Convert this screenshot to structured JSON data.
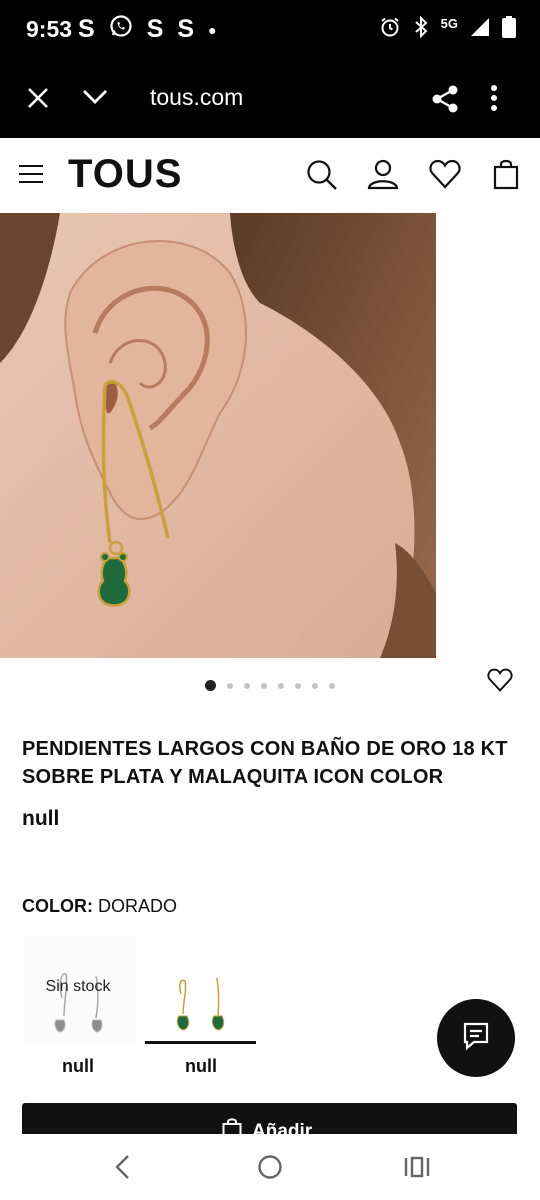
{
  "status": {
    "time": "9:53",
    "notif_icons": [
      "s-app-icon",
      "whatsapp-icon",
      "s-app-icon",
      "s-app-icon",
      "dot-icon"
    ],
    "notif_s": "S",
    "network": "5G"
  },
  "browser": {
    "url": "tous.com"
  },
  "site": {
    "logo": "TOUS"
  },
  "product": {
    "title": "PENDIENTES LARGOS CON BAÑO DE ORO 18 KT SOBRE PLATA Y MALAQUITA ICON COLOR",
    "price": "null",
    "color_label": "COLOR:",
    "color_value": "DORADO",
    "carousel": {
      "total": 8,
      "active": 1
    },
    "variants": [
      {
        "label": "null",
        "badge": "Sin stock",
        "selected": false
      },
      {
        "label": "null",
        "badge": "",
        "selected": true
      }
    ],
    "add_button": "Añadir"
  },
  "colors": {
    "brand": "#111111",
    "gold": "#c9a03a",
    "malachite": "#1f6b3e"
  }
}
